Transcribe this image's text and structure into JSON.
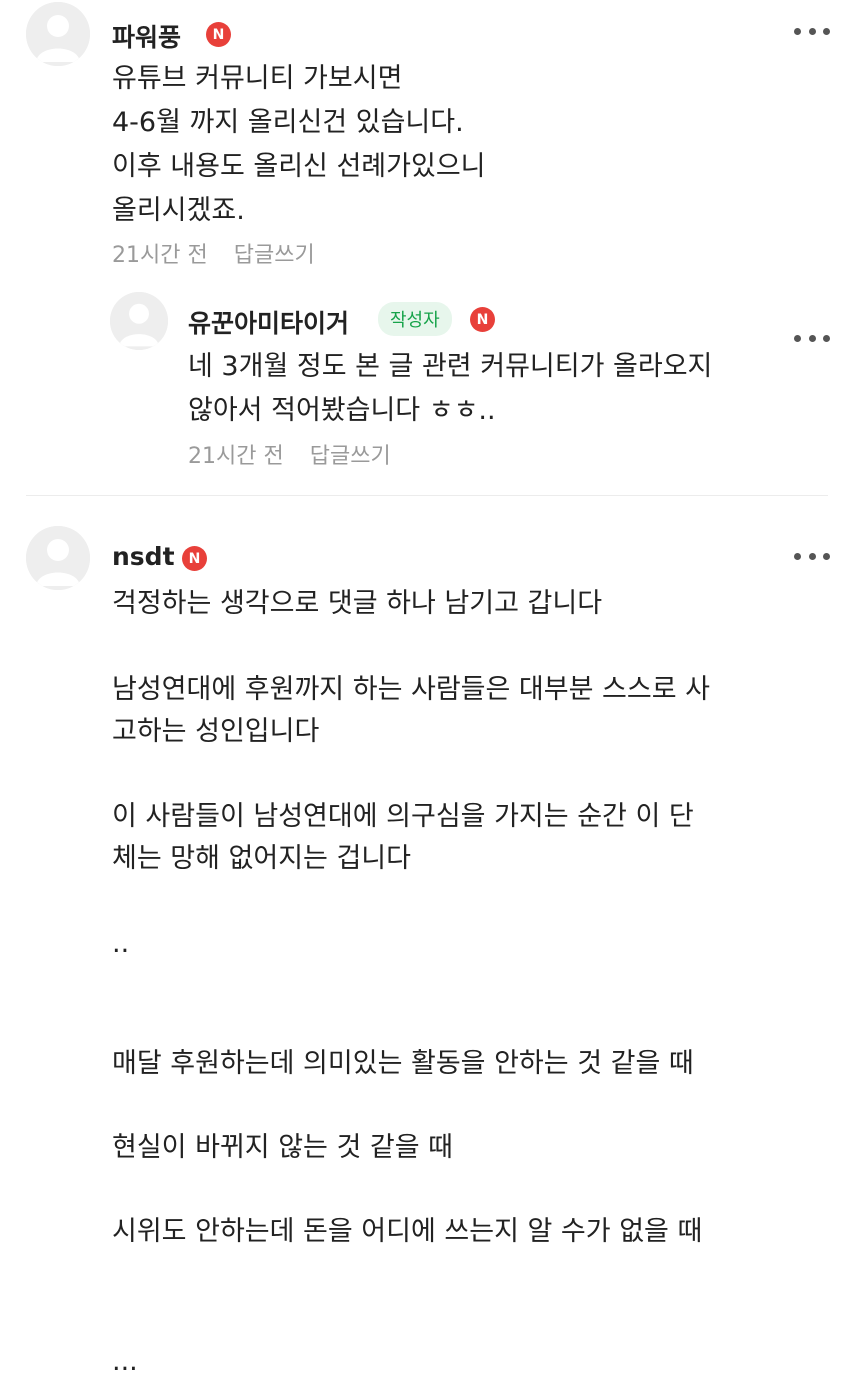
{
  "comments": [
    {
      "nickname": "파워풍",
      "badge": "N",
      "text_lines": [
        "유튜브 커뮤니티 가보시면",
        "4-6월 까지 올리신건 있습니다.",
        "이후 내용도 올리신 선례가있으니",
        "올리시겠죠."
      ],
      "time": "21시간 전",
      "reply_label": "답글쓰기",
      "replies": [
        {
          "nickname": "유꾼아미타이거",
          "author_tag": "작성자",
          "badge": "N",
          "text_lines": [
            "네 3개월 정도 본 글 관련 커뮤니티가 올라오지",
            "않아서 적어봤습니다 ㅎㅎ.."
          ],
          "time": "21시간 전",
          "reply_label": "답글쓰기"
        }
      ]
    },
    {
      "nickname": "nsdt",
      "badge": "N",
      "text_lines": [
        "걱정하는 생각으로 댓글 하나 남기고 갑니다",
        "남성연대에 후원까지 하는 사람들은 대부분 스스로 사",
        "고하는 성인입니다",
        "이 사람들이 남성연대에 의구심을 가지는 순간 이 단",
        "체는 망해 없어지는 겁니다",
        "..",
        "매달 후원하는데 의미있는 활동을 안하는 것 같을 때",
        "현실이 바뀌지 않는 것 같을 때",
        "시위도 안하는데 돈을 어디에 쓰는지 알 수가 없을 때",
        "..."
      ]
    }
  ],
  "icons": {
    "avatar": "default-profile-icon",
    "more": "more-options-icon"
  },
  "colors": {
    "badge": "#e8403a",
    "author_tag_bg": "#e7f6ec",
    "author_tag_text": "#17a34a",
    "meta": "#9a9a9a"
  }
}
